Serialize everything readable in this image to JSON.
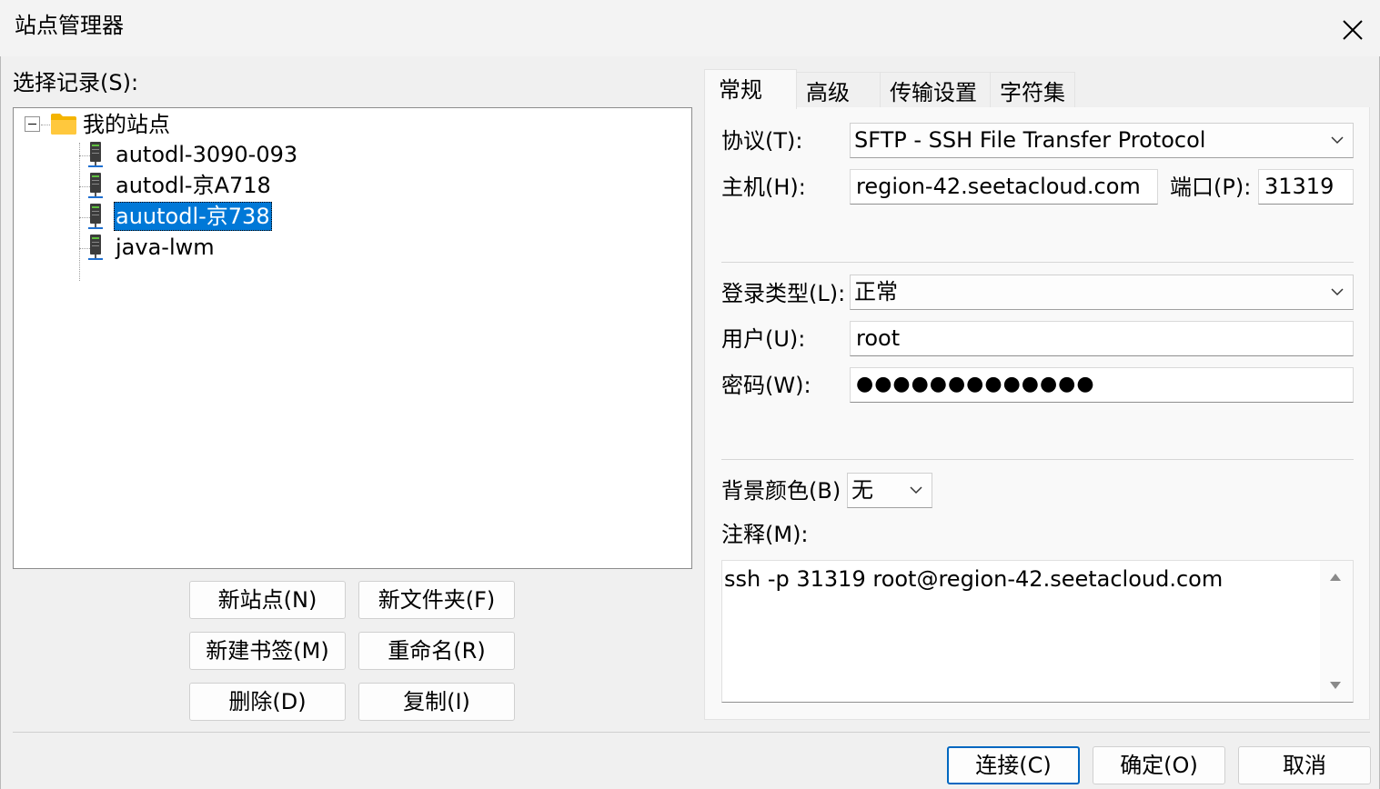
{
  "window": {
    "title": "站点管理器"
  },
  "left": {
    "select_label": "选择记录(S):",
    "tree": {
      "root": "我的站点",
      "items": [
        {
          "label": "autodl-3090-093",
          "selected": false
        },
        {
          "label": "autodl-京A718",
          "selected": false
        },
        {
          "label": "auutodl-京738",
          "selected": true
        },
        {
          "label": "java-lwm",
          "selected": false
        }
      ]
    },
    "buttons": {
      "new_site": "新站点(N)",
      "new_folder": "新文件夹(F)",
      "new_bookmark": "新建书签(M)",
      "rename": "重命名(R)",
      "delete": "删除(D)",
      "copy": "复制(I)"
    }
  },
  "tabs": [
    "常规",
    "高级",
    "传输设置",
    "字符集"
  ],
  "general": {
    "protocol_label": "协议(T):",
    "protocol_value": "SFTP - SSH File Transfer Protocol",
    "host_label": "主机(H):",
    "host_value": "region-42.seetacloud.com",
    "port_label": "端口(P):",
    "port_value": "31319",
    "logon_type_label": "登录类型(L):",
    "logon_type_value": "正常",
    "user_label": "用户(U):",
    "user_value": "root",
    "password_label": "密码(W):",
    "password_mask": "●●●●●●●●●●●●●",
    "bg_color_label": "背景颜色(B)",
    "bg_color_value": "无",
    "notes_label": "注释(M):",
    "notes_value": "ssh -p 31319 root@region-42.seetacloud.com"
  },
  "footer": {
    "connect": "连接(C)",
    "ok": "确定(O)",
    "cancel": "取消"
  },
  "colors": {
    "selection": "#0078d7",
    "primary_border": "#0067c0",
    "folder": "#f4b400",
    "server": "#3c3c3c"
  }
}
